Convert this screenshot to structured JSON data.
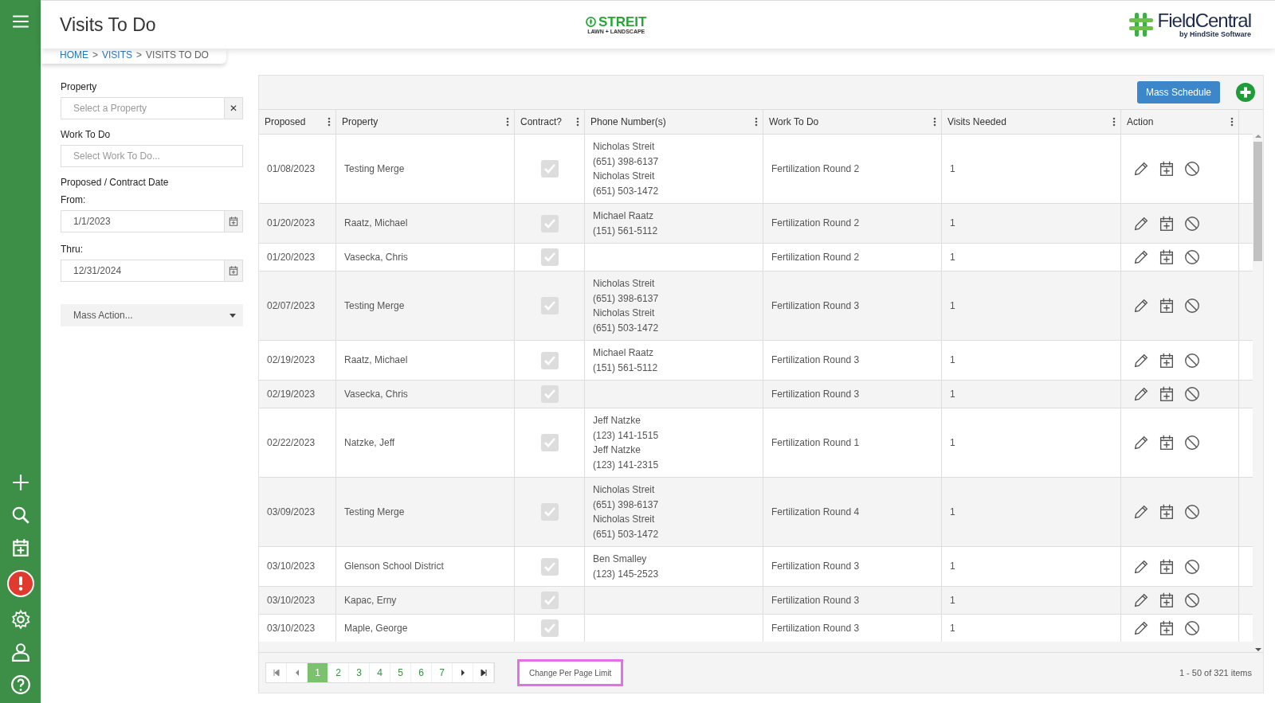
{
  "header": {
    "title": "Visits To Do",
    "company_logo": {
      "name": "STREIT",
      "tagline": "LAWN + LANDSCAPE"
    },
    "product_logo": {
      "name": "FieldCentral",
      "tagline": "by HindSite Software"
    }
  },
  "breadcrumb": [
    {
      "label": "HOME",
      "link": true
    },
    {
      "label": ">",
      "link": false
    },
    {
      "label": "VISITS",
      "link": true
    },
    {
      "label": ">",
      "link": false
    },
    {
      "label": "VISITS TO DO",
      "link": false
    }
  ],
  "filters": {
    "property_label": "Property",
    "property_placeholder": "Select a Property",
    "clear": "✕",
    "work_label": "Work To Do",
    "work_placeholder": "Select Work To Do...",
    "date_label": "Proposed / Contract Date",
    "from_label": "From:",
    "from_value": "1/1/2023",
    "thru_label": "Thru:",
    "thru_value": "12/31/2024",
    "mass_action": "Mass Action..."
  },
  "toolbar": {
    "mass_schedule": "Mass Schedule"
  },
  "table": {
    "columns": [
      "Proposed",
      "Property",
      "Contract?",
      "Phone Number(s)",
      "Work To Do",
      "Visits Needed",
      "Action"
    ],
    "rows": [
      {
        "proposed": "01/08/2023",
        "property": "Testing Merge",
        "contract": true,
        "phones": [
          "Nicholas Streit",
          "(651) 398-6137",
          "Nicholas Streit",
          "(651) 503-1472"
        ],
        "work": "Fertilization Round 2",
        "visits": "1"
      },
      {
        "proposed": "01/20/2023",
        "property": "Raatz, Michael",
        "contract": true,
        "phones": [
          "Michael Raatz",
          "(151) 561-5112"
        ],
        "work": "Fertilization Round 2",
        "visits": "1"
      },
      {
        "proposed": "01/20/2023",
        "property": "Vasecka, Chris",
        "contract": true,
        "phones": [],
        "work": "Fertilization Round 2",
        "visits": "1"
      },
      {
        "proposed": "02/07/2023",
        "property": "Testing Merge",
        "contract": true,
        "phones": [
          "Nicholas Streit",
          "(651) 398-6137",
          "Nicholas Streit",
          "(651) 503-1472"
        ],
        "work": "Fertilization Round 3",
        "visits": "1"
      },
      {
        "proposed": "02/19/2023",
        "property": "Raatz, Michael",
        "contract": true,
        "phones": [
          "Michael Raatz",
          "(151) 561-5112"
        ],
        "work": "Fertilization Round 3",
        "visits": "1"
      },
      {
        "proposed": "02/19/2023",
        "property": "Vasecka, Chris",
        "contract": true,
        "phones": [],
        "work": "Fertilization Round 3",
        "visits": "1"
      },
      {
        "proposed": "02/22/2023",
        "property": "Natzke, Jeff",
        "contract": true,
        "phones": [
          "Jeff Natzke",
          "(123) 141-1515",
          "Jeff Natzke",
          "(123) 141-2315"
        ],
        "work": "Fertilization Round 1",
        "visits": "1"
      },
      {
        "proposed": "03/09/2023",
        "property": "Testing Merge",
        "contract": true,
        "phones": [
          "Nicholas Streit",
          "(651) 398-6137",
          "Nicholas Streit",
          "(651) 503-1472"
        ],
        "work": "Fertilization Round 4",
        "visits": "1"
      },
      {
        "proposed": "03/10/2023",
        "property": "Glenson School District",
        "contract": true,
        "phones": [
          "Ben Smalley",
          "(123) 145-2523"
        ],
        "work": "Fertilization Round 3",
        "visits": "1"
      },
      {
        "proposed": "03/10/2023",
        "property": "Kapac, Erny",
        "contract": true,
        "phones": [],
        "work": "Fertilization Round 3",
        "visits": "1"
      },
      {
        "proposed": "03/10/2023",
        "property": "Maple, George",
        "contract": true,
        "phones": [],
        "work": "Fertilization Round 3",
        "visits": "1"
      }
    ]
  },
  "pager": {
    "pages": [
      {
        "label": "1",
        "selected": true
      },
      {
        "label": "2",
        "selected": false
      },
      {
        "label": "3",
        "selected": false
      },
      {
        "label": "4",
        "selected": false
      },
      {
        "label": "5",
        "selected": false
      },
      {
        "label": "6",
        "selected": false
      },
      {
        "label": "7",
        "selected": false
      }
    ],
    "per_page_button": "Change Per Page Limit",
    "summary": "1 - 50 of 321 items"
  }
}
